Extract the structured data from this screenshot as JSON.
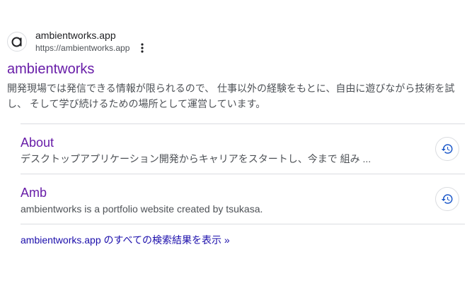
{
  "site": {
    "name": "ambientworks.app",
    "url": "https://ambientworks.app",
    "favicon_icon": "letter-a-icon",
    "more_icon": "more-vert-icon"
  },
  "result": {
    "title": "ambientworks",
    "snippet": "開発現場では発信できる情報が限られるので、 仕事以外の経験をもとに、自由に遊びながら技術を試し、 そして学び続けるための場所として運営しています。"
  },
  "sitelinks": [
    {
      "title": "About",
      "description": "デスクトップアプリケーション開発からキャリアをスタートし、今まで 組み ...",
      "icon": "history-icon"
    },
    {
      "title": "Amb",
      "description": "ambientworks is a portfolio website created by tsukasa.",
      "icon": "history-icon"
    }
  ],
  "more_results_label": "ambientworks.app のすべての検索結果を表示 »",
  "colors": {
    "visited_link": "#681da8",
    "link": "#1a0dab",
    "snippet_text": "#4d5156",
    "history_icon": "#1a57c9",
    "divider": "#dadce0"
  }
}
